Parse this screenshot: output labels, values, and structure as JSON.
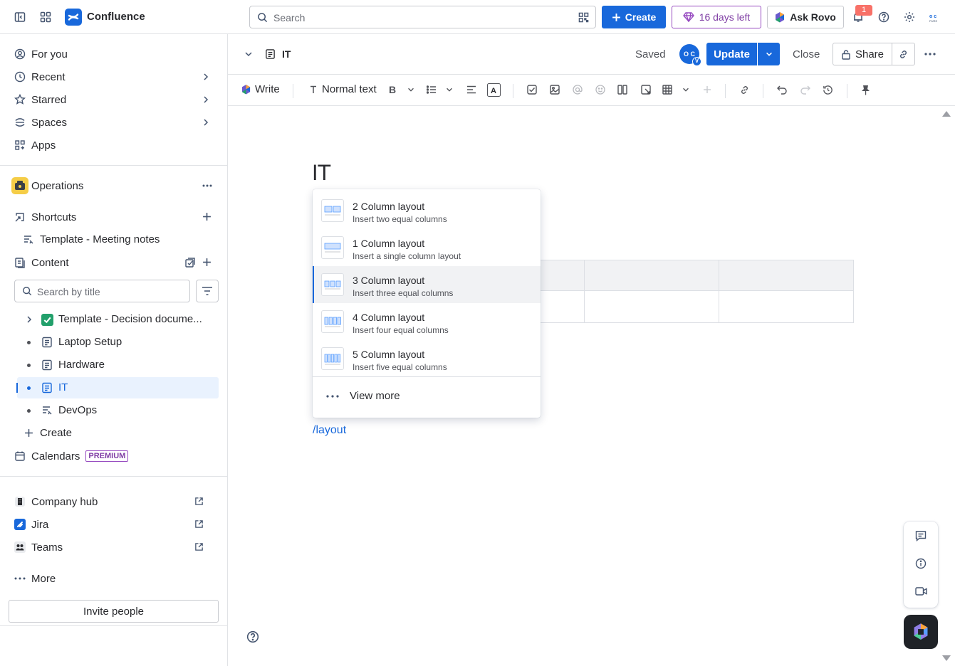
{
  "topbar": {
    "brand": "Confluence",
    "search_placeholder": "Search",
    "create_label": "Create",
    "trial_label": "16 days left",
    "rovo_label": "Ask Rovo",
    "notification_count": "1"
  },
  "sidebar": {
    "nav": [
      {
        "label": "For you"
      },
      {
        "label": "Recent"
      },
      {
        "label": "Starred"
      },
      {
        "label": "Spaces"
      },
      {
        "label": "Apps"
      }
    ],
    "space_name": "Operations",
    "shortcuts_label": "Shortcuts",
    "shortcut_item": "Template - Meeting notes",
    "content_label": "Content",
    "search_placeholder": "Search by title",
    "tree": [
      {
        "label": "Template - Decision docume..."
      },
      {
        "label": "Laptop Setup"
      },
      {
        "label": "Hardware"
      },
      {
        "label": "IT"
      },
      {
        "label": "DevOps"
      }
    ],
    "create_label": "Create",
    "calendars_label": "Calendars",
    "premium_label": "PREMIUM",
    "apps": [
      {
        "label": "Company hub"
      },
      {
        "label": "Jira"
      },
      {
        "label": "Teams"
      }
    ],
    "more_label": "More",
    "invite_label": "Invite people"
  },
  "pageheader": {
    "title": "IT",
    "status": "Saved",
    "avatar_initials": "O C",
    "avatar_badge": "V",
    "update_label": "Update",
    "close_label": "Close",
    "share_label": "Share"
  },
  "toolbar": {
    "write_label": "Write",
    "text_style": "Normal text"
  },
  "editor": {
    "title": "IT",
    "slash_command": "/layout"
  },
  "menu": {
    "options": [
      {
        "title": "2 Column layout",
        "desc": "Insert two equal columns"
      },
      {
        "title": "1 Column layout",
        "desc": "Insert a single column layout"
      },
      {
        "title": "3 Column layout",
        "desc": "Insert three equal columns"
      },
      {
        "title": "4 Column layout",
        "desc": "Insert four equal columns"
      },
      {
        "title": "5 Column layout",
        "desc": "Insert five equal columns"
      }
    ],
    "selected_index": 2,
    "view_more_label": "View more"
  },
  "colors": {
    "accent": "#1868db",
    "trial": "#803fa5",
    "badge": "#f87168"
  }
}
